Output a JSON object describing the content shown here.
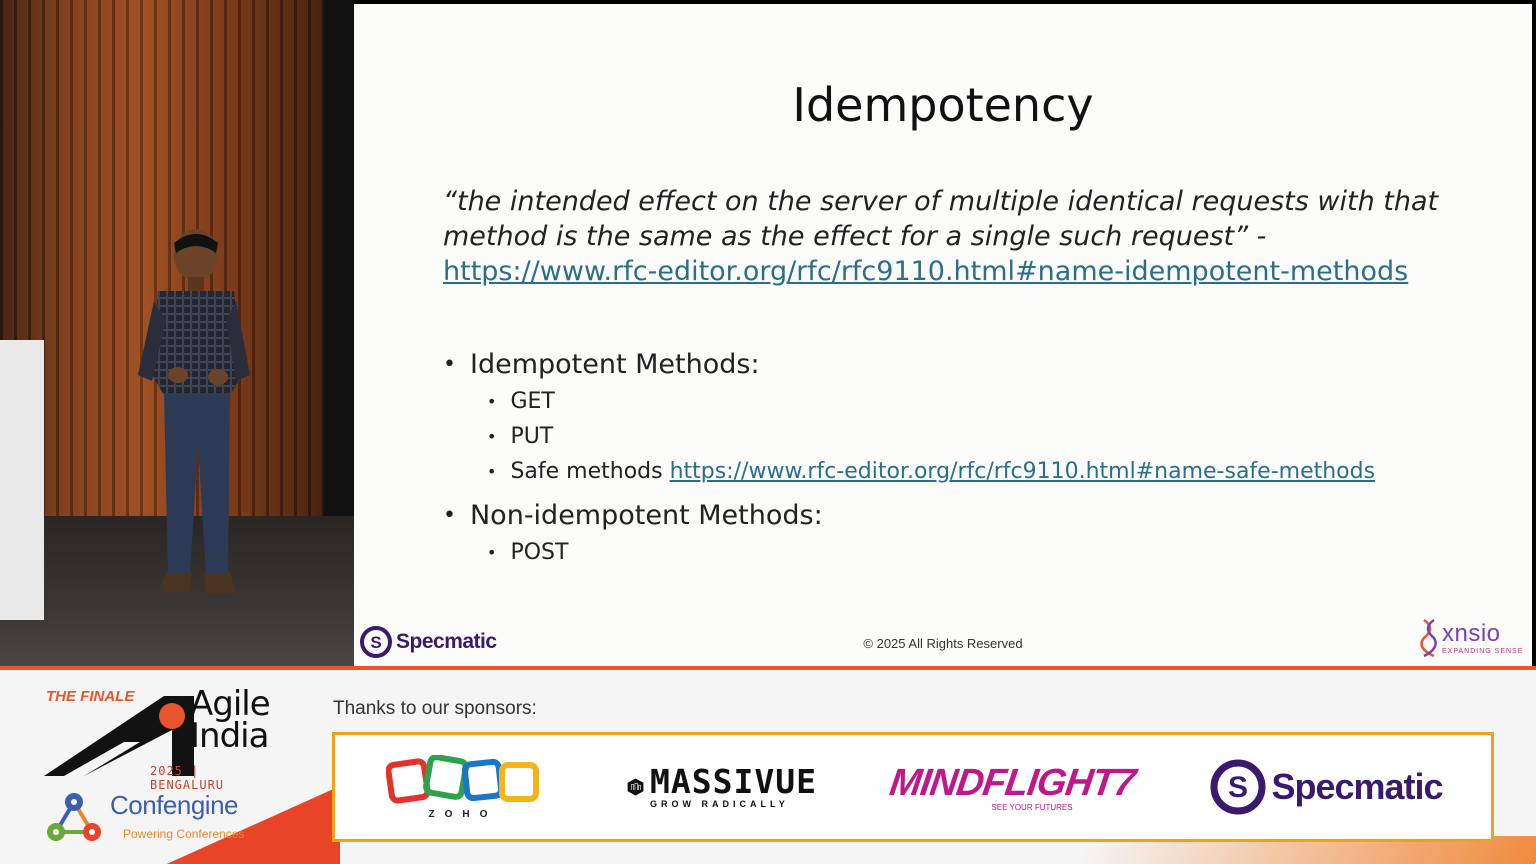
{
  "slide": {
    "title": "Idempotency",
    "quote": "“the intended effect on the server of multiple identical requests with that method is the same as the effect for a single such request” -",
    "quote_link": "https://www.rfc-editor.org/rfc/rfc9110.html#name-idempotent-methods",
    "bullets": [
      {
        "label": "Idempotent Methods:",
        "children": [
          "GET",
          "PUT",
          "Safe methods"
        ]
      },
      {
        "label": "Non-idempotent Methods:",
        "children": [
          "POST"
        ]
      }
    ],
    "safe_methods_link": "https://www.rfc-editor.org/rfc/rfc9110.html#name-safe-methods",
    "footer": {
      "left_logo": "Specmatic",
      "copyright": "© 2025 All Rights Reserved",
      "right_logo": "xnsio",
      "right_tagline": "EXPANDING SENSE"
    }
  },
  "banner": {
    "finale": "THE FINALE",
    "event_line1": "Agile",
    "event_line2": "India",
    "event_year": "2025 | BENGALURU",
    "platform": "Confengine",
    "platform_tagline": "Powering Conferences",
    "thanks": "Thanks to our sponsors:",
    "sponsors": [
      {
        "name": "ZOHO"
      },
      {
        "name": "MASSIVUE",
        "tagline": "GROW RADICALLY"
      },
      {
        "name": "MINDFLIGHT7",
        "tagline": "SEE YOUR FUTURES"
      },
      {
        "name": "Specmatic"
      }
    ]
  },
  "colors": {
    "link": "#2a6f8a",
    "accent_orange": "#e8552c",
    "sponsor_border": "#f2a21a",
    "specmatic_purple": "#3a1a6e",
    "mindflight_pink": "#c0188a"
  }
}
